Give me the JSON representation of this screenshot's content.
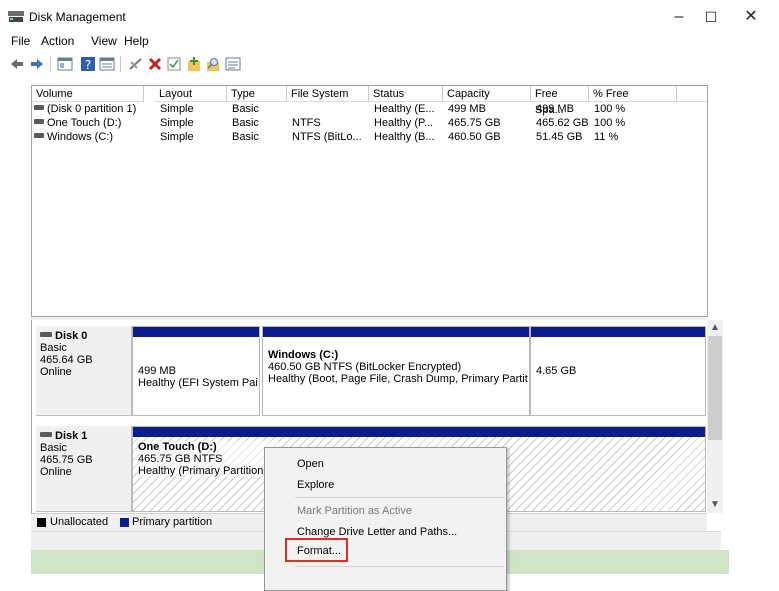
{
  "window": {
    "title": "Disk Management",
    "controls": {
      "minimize": "–",
      "maximize": "☐",
      "close": "✕"
    }
  },
  "menu": [
    "File",
    "Action",
    "View",
    "Help"
  ],
  "toolbar_icons": [
    "back-icon",
    "forward-icon",
    "properties-pane-icon",
    "help-icon",
    "view-icon",
    "connect-icon",
    "delete-icon",
    "check-icon",
    "new-volume-icon",
    "search-icon",
    "list-icon"
  ],
  "volume_table": {
    "columns": [
      "Volume",
      "Layout",
      "Type",
      "File System",
      "Status",
      "Capacity",
      "Free Spa...",
      "% Free"
    ],
    "rows": [
      [
        "(Disk 0 partition 1)",
        "Simple",
        "Basic",
        "",
        "Healthy (E...",
        "499 MB",
        "499 MB",
        "100 %"
      ],
      [
        "One Touch (D:)",
        "Simple",
        "Basic",
        "NTFS",
        "Healthy (P...",
        "465.75 GB",
        "465.62 GB",
        "100 %"
      ],
      [
        "Windows (C:)",
        "Simple",
        "Basic",
        "NTFS (BitLo...",
        "Healthy (B...",
        "460.50 GB",
        "51.45 GB",
        "11 %"
      ]
    ]
  },
  "disks": [
    {
      "name": "Disk 0",
      "type": "Basic",
      "size": "465.64 GB",
      "status": "Online",
      "partitions": [
        {
          "title": "",
          "line1": "499 MB",
          "line2": "Healthy (EFI System Pai"
        },
        {
          "title": "Windows  (C:)",
          "line1": "460.50 GB NTFS (BitLocker Encrypted)",
          "line2": "Healthy (Boot, Page File, Crash Dump, Primary Partit"
        },
        {
          "title": "",
          "line1": "4.65 GB",
          "line2": ""
        }
      ]
    },
    {
      "name": "Disk 1",
      "type": "Basic",
      "size": "465.75 GB",
      "status": "Online",
      "partitions": [
        {
          "title": "One Touch  (D:)",
          "line1": "465.75 GB NTFS",
          "line2": "Healthy (Primary Partition"
        }
      ]
    }
  ],
  "legend": {
    "unallocated": "Unallocated",
    "primary": "Primary partition",
    "colors": {
      "unallocated": "#000000",
      "primary": "#0b1c8c"
    }
  },
  "context_menu": {
    "items": [
      "Open",
      "Explore",
      "Mark Partition as Active",
      "Change Drive Letter and Paths...",
      "Format..."
    ],
    "disabled": [
      "Mark Partition as Active"
    ],
    "highlighted": "Format..."
  },
  "colors": {
    "partition_bar": "#0b1c8c",
    "highlight_box": "#d9302c"
  }
}
